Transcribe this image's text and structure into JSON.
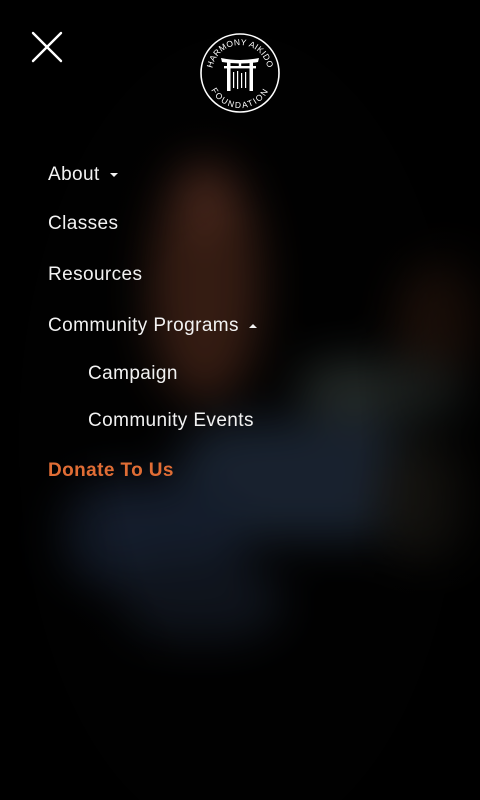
{
  "header": {
    "close_icon": "close-icon",
    "logo": {
      "top_text": "HARMONY AIKIDO",
      "bottom_text": "FOUNDATION",
      "icon": "torii-gate-icon"
    }
  },
  "menu": {
    "items": [
      {
        "label": "About",
        "caret": "down"
      },
      {
        "label": "Classes"
      },
      {
        "label": "Resources"
      },
      {
        "label": "Community Programs",
        "caret": "up"
      },
      {
        "label": "Campaign",
        "sub": true
      },
      {
        "label": "Community Events",
        "sub": true
      },
      {
        "label": "Donate To Us"
      }
    ]
  },
  "colors": {
    "text": "#f2f2f2",
    "accent": "#e06d35",
    "background": "#050505"
  }
}
